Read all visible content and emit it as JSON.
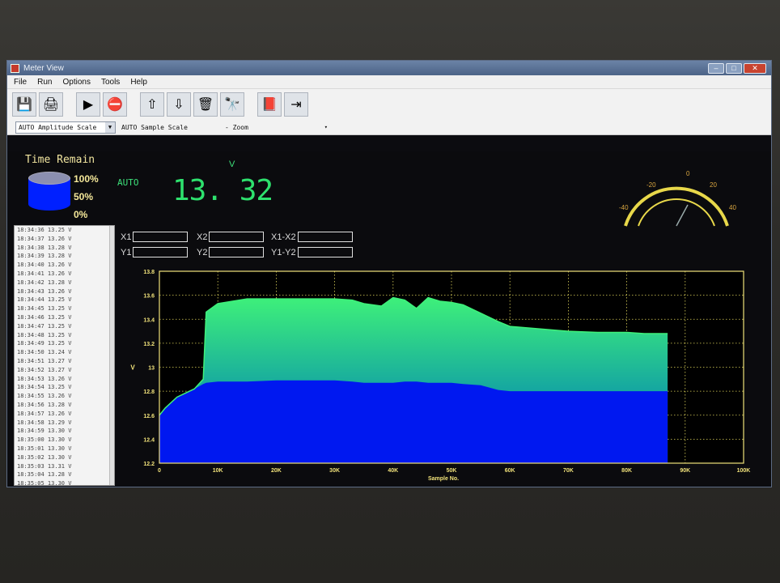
{
  "window": {
    "title": "Meter View"
  },
  "menu": [
    "File",
    "Run",
    "Options",
    "Tools",
    "Help"
  ],
  "toolbar": [
    {
      "name": "save-icon",
      "glyph": "💾"
    },
    {
      "name": "print-icon",
      "glyph": "🖨"
    },
    {
      "name": "run-icon",
      "glyph": "▶"
    },
    {
      "name": "stop-icon",
      "glyph": "⛔"
    },
    {
      "name": "arrow-up-icon",
      "glyph": "⇧"
    },
    {
      "name": "arrow-down-icon",
      "glyph": "⇩"
    },
    {
      "name": "trash-icon",
      "glyph": "🗑"
    },
    {
      "name": "binoculars-icon",
      "glyph": "🔭"
    },
    {
      "name": "help-book-icon",
      "glyph": "📕"
    },
    {
      "name": "exit-icon",
      "glyph": "⇥"
    }
  ],
  "options": {
    "amplitude_scale": "AUTO Amplitude Scale",
    "sample_scale": "AUTO Sample Scale",
    "zoom": "- Zoom"
  },
  "time_remain": {
    "title": "Time Remain",
    "labels": [
      "100%",
      "50%",
      "0%"
    ]
  },
  "meter": {
    "mode": "AUTO",
    "unit": "V",
    "value": "13. 32"
  },
  "gauge": {
    "ticks": [
      "-40",
      "-20",
      "0",
      "20",
      "40"
    ],
    "needle_value": 0
  },
  "log": [
    "18:34:36  13.25 V",
    "18:34:37  13.26 V",
    "18:34:38  13.28 V",
    "18:34:39  13.28 V",
    "18:34:40  13.26 V",
    "18:34:41  13.26 V",
    "18:34:42  13.28 V",
    "18:34:43  13.26 V",
    "18:34:44  13.25 V",
    "18:34:45  13.25 V",
    "18:34:46  13.25 V",
    "18:34:47  13.25 V",
    "18:34:48  13.25 V",
    "18:34:49  13.25 V",
    "18:34:50  13.24 V",
    "18:34:51  13.27 V",
    "18:34:52  13.27 V",
    "18:34:53  13.26 V",
    "18:34:54  13.25 V",
    "18:34:55  13.26 V",
    "18:34:56  13.28 V",
    "18:34:57  13.26 V",
    "18:34:58  13.29 V",
    "18:34:59  13.30 V",
    "18:35:00  13.30 V",
    "18:35:01  13.30 V",
    "18:35:02  13.30 V",
    "18:35:03  13.31 V",
    "18:35:04  13.28 V",
    "18:35:05  13.30 V"
  ],
  "cursors": {
    "x1": "X1",
    "x2": "X2",
    "x1_x2": "X1-X2",
    "y1": "Y1",
    "y2": "Y2",
    "y1_y2": "Y1-Y2"
  },
  "colors": {
    "envelope": "#3ef07a",
    "fill_top": "#16a8a0",
    "base": "#0018f0",
    "grid": "#ddd35a",
    "axis": "#f1e27a"
  },
  "chart_data": {
    "type": "area",
    "xlabel": "Sample No.",
    "ylabel": "V",
    "xlim": [
      0,
      100000
    ],
    "ylim": [
      12.2,
      13.8
    ],
    "x_ticks": [
      "0",
      "10K",
      "20K",
      "30K",
      "40K",
      "50K",
      "60K",
      "70K",
      "80K",
      "90K",
      "100K"
    ],
    "y_ticks": [
      "12.2",
      "12.4",
      "12.6",
      "12.8",
      "13",
      "13.2",
      "13.4",
      "13.6",
      "13.8"
    ],
    "series": [
      {
        "x": [
          0,
          1000,
          3000,
          6000,
          7500,
          8000,
          10000,
          15000,
          20000,
          25000,
          30000,
          33000,
          35000,
          38000,
          40000,
          42000,
          44000,
          46000,
          48000,
          50000,
          52000,
          55000,
          58000,
          60000,
          65000,
          70000,
          75000,
          80000,
          83000,
          84000,
          87000
        ],
        "max": [
          12.6,
          12.66,
          12.75,
          12.82,
          12.9,
          13.46,
          13.53,
          13.57,
          13.57,
          13.57,
          13.57,
          13.56,
          13.53,
          13.51,
          13.58,
          13.56,
          13.49,
          13.58,
          13.55,
          13.54,
          13.52,
          13.45,
          13.38,
          13.34,
          13.32,
          13.3,
          13.29,
          13.29,
          13.28,
          13.28,
          13.28
        ],
        "base": [
          12.6,
          12.66,
          12.75,
          12.82,
          12.86,
          12.87,
          12.88,
          12.88,
          12.89,
          12.89,
          12.89,
          12.88,
          12.87,
          12.87,
          12.87,
          12.88,
          12.88,
          12.87,
          12.87,
          12.87,
          12.86,
          12.85,
          12.81,
          12.8,
          12.8,
          12.8,
          12.8,
          12.8,
          12.8,
          12.8,
          12.8
        ]
      }
    ]
  }
}
